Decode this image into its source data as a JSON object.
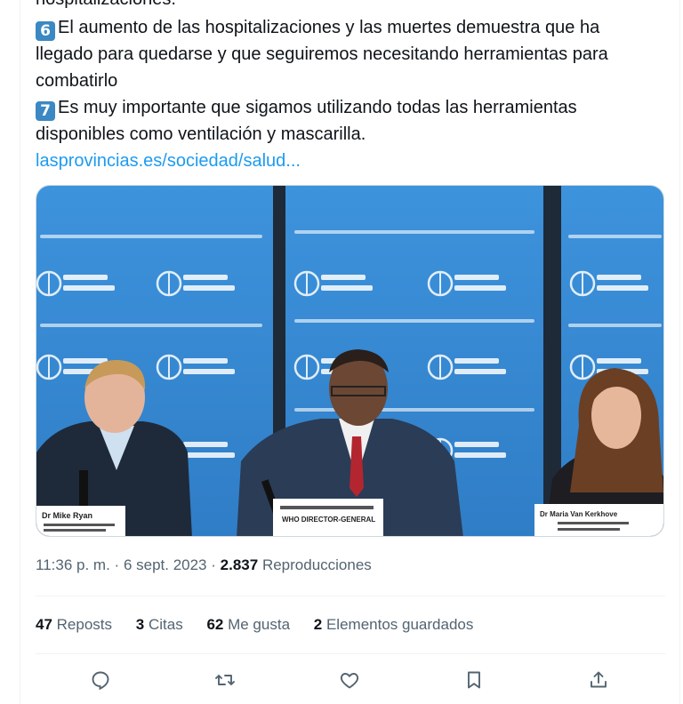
{
  "tweet": {
    "cutoff_line": "hospitalizaciones.",
    "point6_emoji": "6",
    "point6_line1": "El aumento de las hospitalizaciones y las muertes demuestra que ha",
    "point6_line2": "llegado para quedarse y que seguiremos necesitando herramientas para",
    "point6_line3": "combatirlo",
    "point7_emoji": "7",
    "point7_line1": "Es muy importante que sigamos utilizando todas las herramientas",
    "point7_line2": "disponibles como ventilación y mascarilla.",
    "link": "lasprovincias.es/sociedad/salud..."
  },
  "media": {
    "banner_logo": "World Health Organization",
    "nameplate_left": "Dr Mike Ryan",
    "nameplate_center": "WHO DIRECTOR-GENERAL",
    "nameplate_right": "Dr Maria Van Kerkhove"
  },
  "meta": {
    "time": "11:36 p. m.",
    "separator": "·",
    "date": "6 sept. 2023",
    "views_count": "2.837",
    "views_label": "Reproducciones"
  },
  "stats": [
    {
      "count": "47",
      "label": "Reposts"
    },
    {
      "count": "3",
      "label": "Citas"
    },
    {
      "count": "62",
      "label": "Me gusta"
    },
    {
      "count": "2",
      "label": "Elementos guardados"
    }
  ],
  "actions": [
    "reply-icon",
    "retweet-icon",
    "like-icon",
    "bookmark-icon",
    "share-icon"
  ],
  "colors": {
    "link": "#1d9bf0",
    "muted": "#536471",
    "text": "#0f1419",
    "who_blue": "#3a8fd9"
  }
}
